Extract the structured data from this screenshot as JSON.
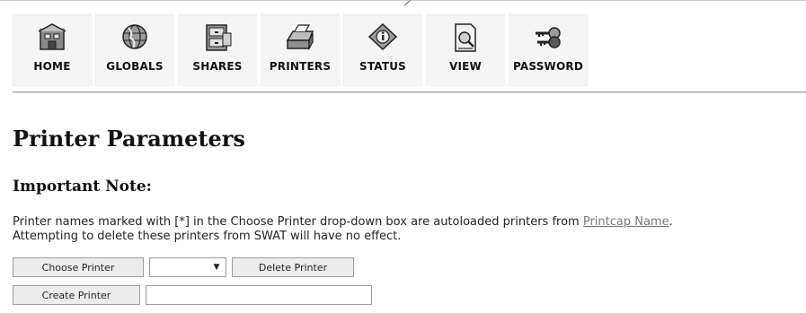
{
  "toolbar": {
    "items": [
      {
        "label": "HOME",
        "icon": "home-icon"
      },
      {
        "label": "GLOBALS",
        "icon": "globe-icon"
      },
      {
        "label": "SHARES",
        "icon": "shares-icon"
      },
      {
        "label": "PRINTERS",
        "icon": "printer-icon"
      },
      {
        "label": "STATUS",
        "icon": "status-icon"
      },
      {
        "label": "VIEW",
        "icon": "view-icon"
      },
      {
        "label": "PASSWORD",
        "icon": "keys-icon"
      }
    ]
  },
  "page": {
    "title": "Printer Parameters",
    "subtitle": "Important Note:",
    "note_part1": "Printer names marked with [*] in the Choose Printer drop-down box are autoloaded printers from ",
    "note_link": "Printcap Name",
    "note_part2": ".",
    "note_line2": "Attempting to delete these printers from SWAT will have no effect."
  },
  "controls": {
    "choose_label": "Choose Printer",
    "select_value": "",
    "delete_label": "Delete Printer",
    "create_label": "Create Printer",
    "create_value": ""
  }
}
